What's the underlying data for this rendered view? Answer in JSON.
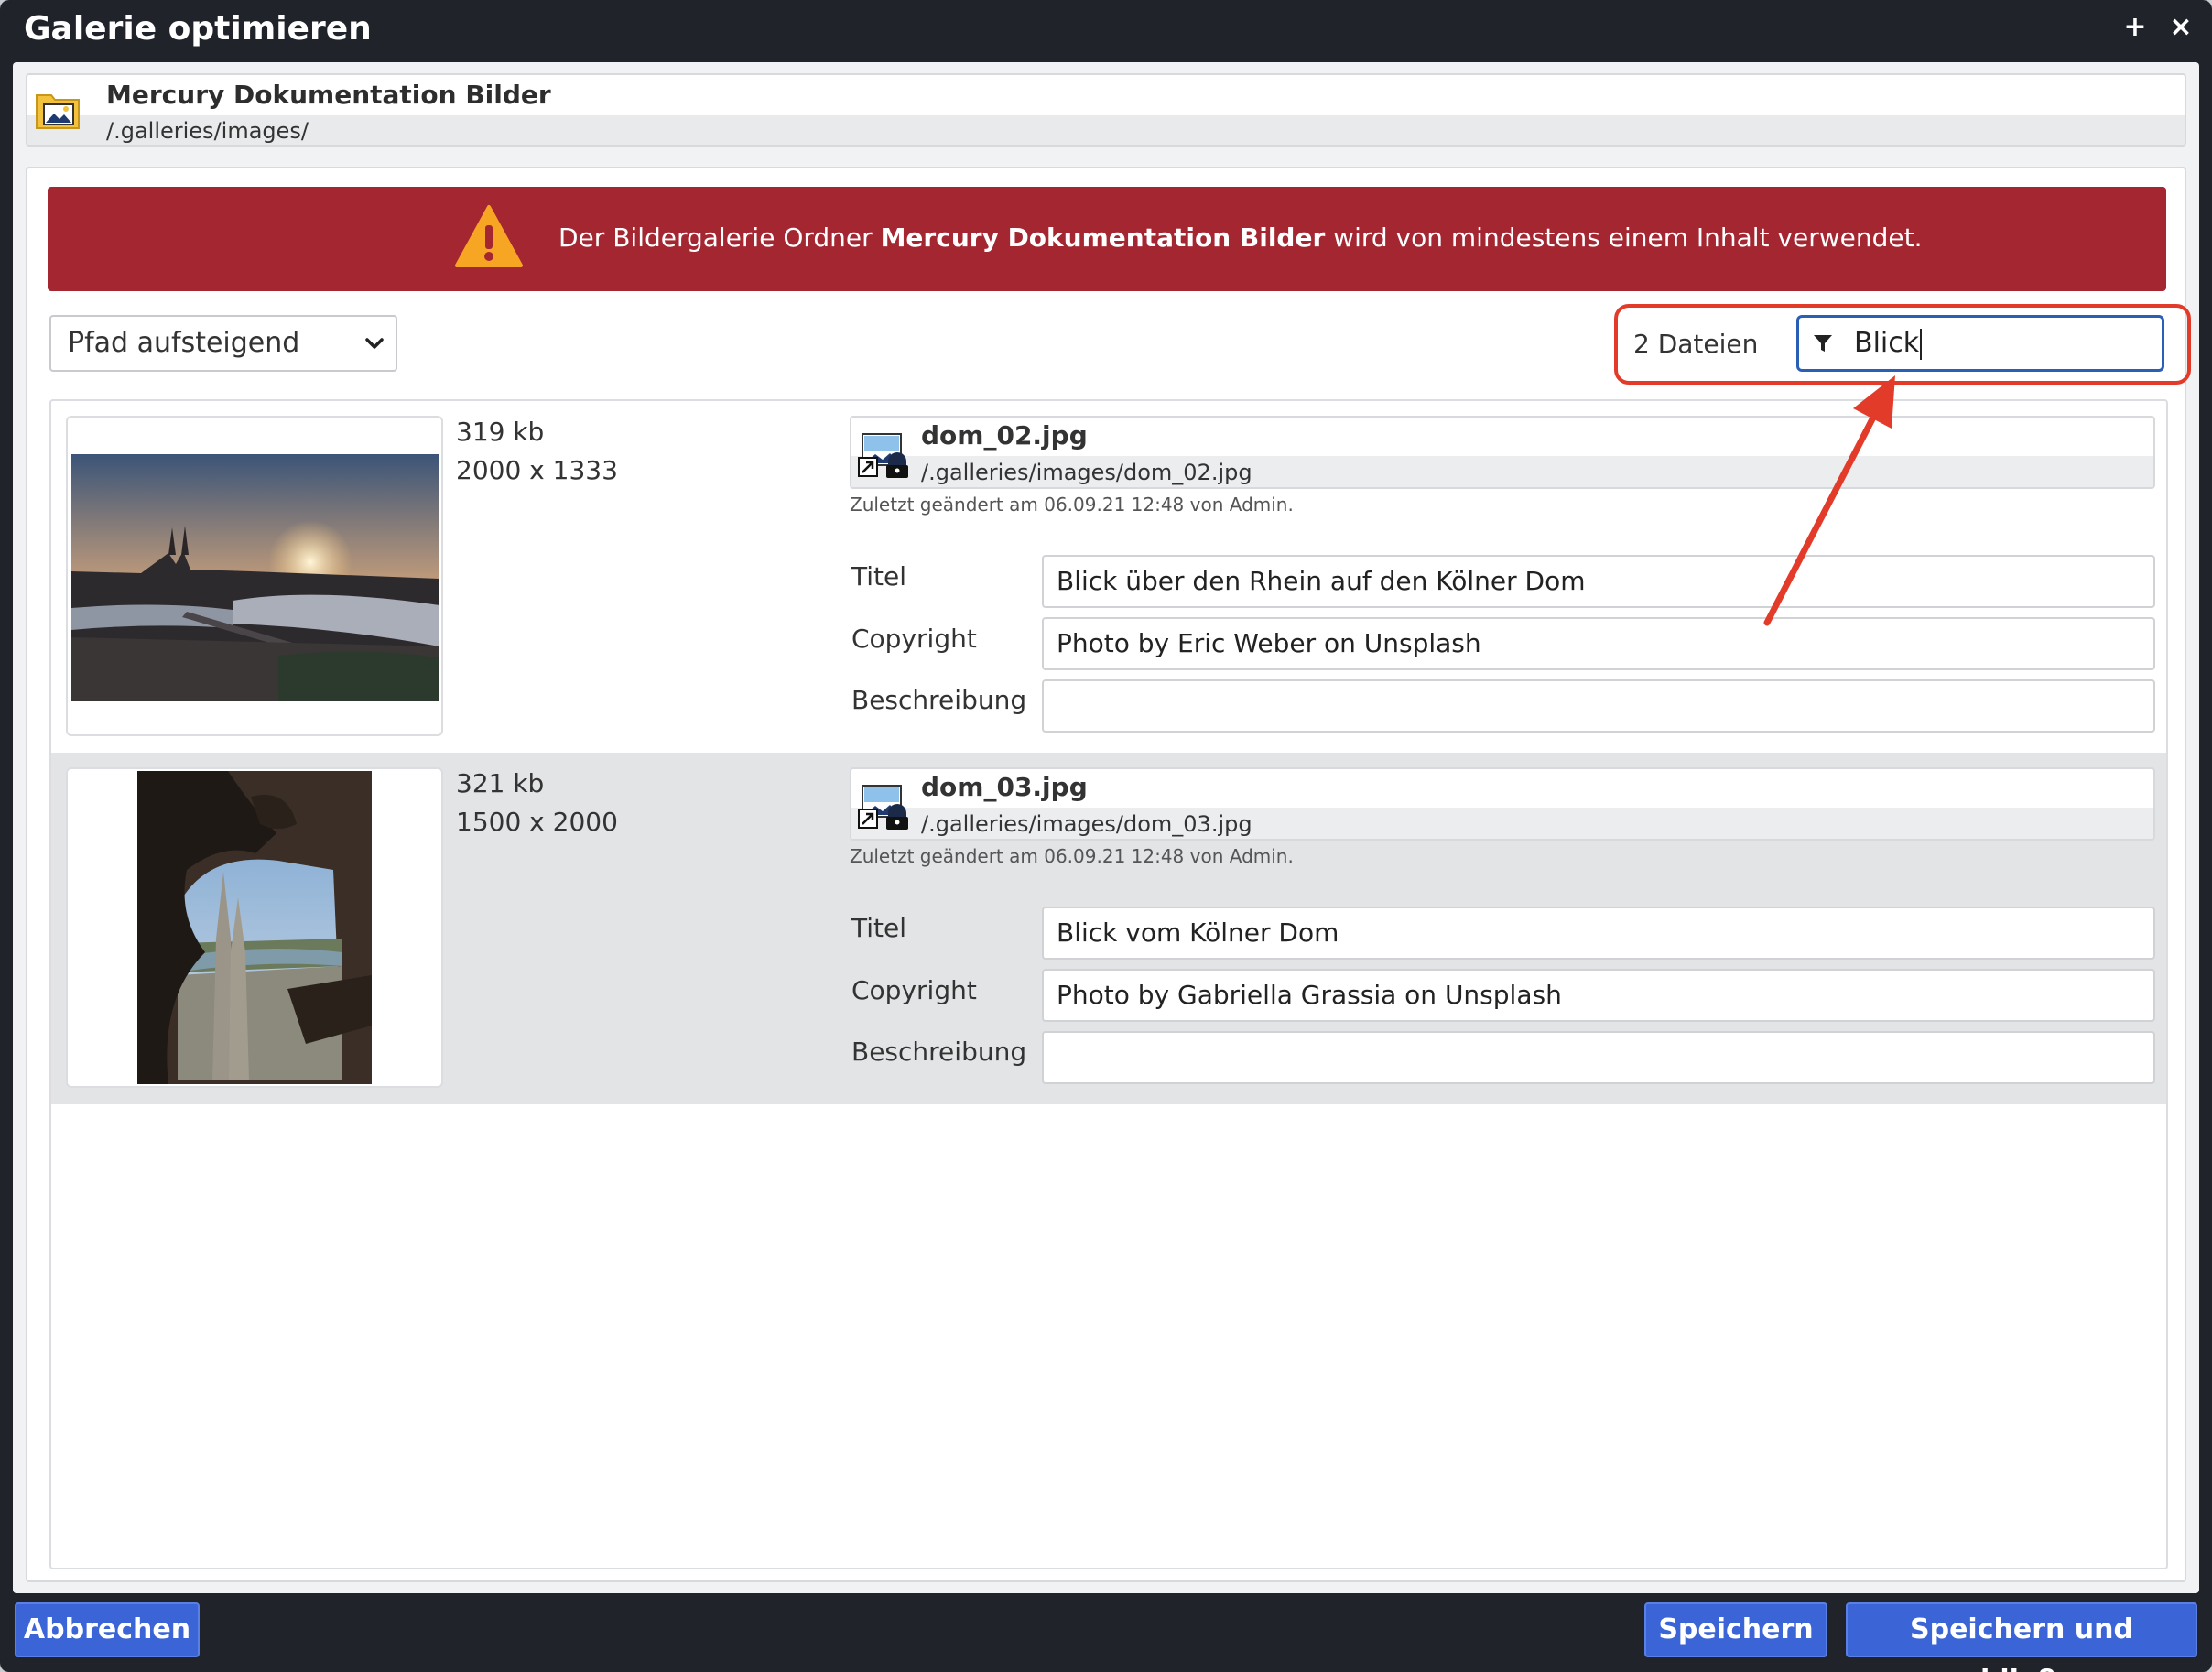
{
  "dialog": {
    "title": "Galerie optimieren",
    "add_label": "+",
    "close_label": "×"
  },
  "folder": {
    "name": "Mercury Dokumentation Bilder",
    "path": "/.galleries/images/"
  },
  "alert": {
    "text_before": "Der Bildergalerie Ordner ",
    "text_bold": "Mercury Dokumentation Bilder",
    "text_after": " wird von mindestens einem Inhalt verwendet."
  },
  "sort": {
    "selected": "Pfad aufsteigend"
  },
  "filter": {
    "count": "2 Dateien",
    "value": "Blick"
  },
  "labels": {
    "title": "Titel",
    "copyright": "Copyright",
    "description": "Beschreibung"
  },
  "images": [
    {
      "size": "319 kb",
      "dimensions": "2000 x 1333",
      "name": "dom_02.jpg",
      "path": "/.galleries/images/dom_02.jpg",
      "modified": "Zuletzt geändert am 06.09.21 12:48 von Admin.",
      "title": "Blick über den Rhein auf den Kölner Dom",
      "copyright": "Photo by Eric Weber on Unsplash",
      "description": ""
    },
    {
      "size": "321 kb",
      "dimensions": "1500 x 2000",
      "name": "dom_03.jpg",
      "path": "/.galleries/images/dom_03.jpg",
      "modified": "Zuletzt geändert am 06.09.21 12:48 von Admin.",
      "title": "Blick vom Kölner Dom",
      "copyright": "Photo by Gabriella Grassia on Unsplash",
      "description": ""
    }
  ],
  "buttons": {
    "cancel": "Abbrechen",
    "save": "Speichern",
    "save_close": "Speichern und schließen"
  },
  "colors": {
    "alert_bg": "#a42631",
    "primary_button": "#3b65d6",
    "highlight": "#e33b2a",
    "titlebar": "#20232a"
  }
}
